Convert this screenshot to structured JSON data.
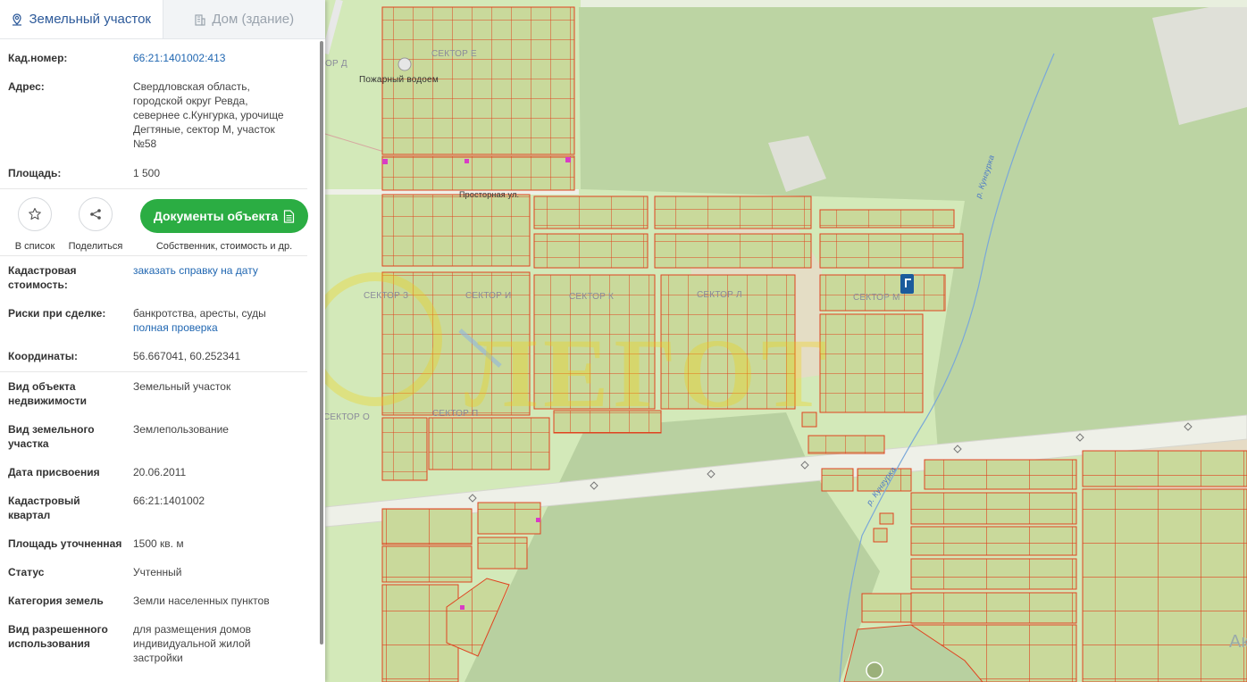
{
  "tabs": [
    {
      "label": "Земельный участок",
      "icon": "map-pin-icon",
      "active": true
    },
    {
      "label": "Дом (здание)",
      "icon": "building-icon",
      "active": false
    }
  ],
  "info_top": {
    "cad_number": {
      "label": "Кад.номер:",
      "value": "66:21:1401002:413"
    },
    "address": {
      "label": "Адрес:",
      "lines": [
        "Свердловская область,",
        "городской округ Ревда,",
        "севернее с.Кунгурка, урочище",
        "Дегтяные, сектор М, участок",
        "№58"
      ]
    },
    "area": {
      "label": "Площадь:",
      "value": "1 500"
    }
  },
  "actions": {
    "favorite": {
      "caption": "В список",
      "icon": "star-icon"
    },
    "share": {
      "caption": "Поделиться",
      "icon": "share-icon"
    },
    "documents": {
      "label": "Документы объекта",
      "caption": "Собственник, стоимость и др.",
      "icon": "document-icon"
    }
  },
  "details": [
    {
      "label": [
        "Кадастровая",
        "стоимость:"
      ],
      "value": [
        "заказать справку на дату"
      ],
      "link": [
        true
      ]
    },
    {
      "label": [
        "Риски при сделке:"
      ],
      "value": [
        "банкротства, аресты, суды",
        "полная проверка"
      ],
      "link": [
        false,
        true
      ]
    },
    {
      "label": [
        "Координаты:"
      ],
      "value": [
        "56.667041, 60.252341"
      ],
      "link": [
        false
      ]
    },
    {
      "label": [
        "Вид объекта",
        "недвижимости"
      ],
      "value": [
        "Земельный участок"
      ],
      "link": [
        false
      ]
    },
    {
      "label": [
        "Вид земельного",
        "участка"
      ],
      "value": [
        "Землепользование"
      ],
      "link": [
        false
      ]
    },
    {
      "label": [
        "Дата присвоения"
      ],
      "value": [
        "20.06.2011"
      ],
      "link": [
        false
      ]
    },
    {
      "label": [
        "Кадастровый",
        "квартал"
      ],
      "value": [
        "66:21:1401002"
      ],
      "link": [
        false
      ]
    },
    {
      "label": [
        "Площадь уточненная"
      ],
      "value": [
        "1500 кв. м"
      ],
      "link": [
        false
      ]
    },
    {
      "label": [
        "Статус"
      ],
      "value": [
        "Учтенный"
      ],
      "link": [
        false
      ]
    },
    {
      "label": [
        "Категория земель"
      ],
      "value": [
        "Земли населенных пунктов"
      ],
      "link": [
        false
      ]
    },
    {
      "label": [
        "Вид разрешенного",
        "использования"
      ],
      "value": [
        "для размещения домов",
        "индивидуальной жилой",
        "застройки"
      ],
      "link": [
        false
      ]
    }
  ],
  "map": {
    "labels": {
      "sector_e": "СЕКТОР Е",
      "sector_d": "ОР Д",
      "fire_pond": "Пожарный водоем",
      "street": "Просторная ул.",
      "sector_z": "СЕКТОР З",
      "sector_i": "СЕКТОР И",
      "sector_k": "СЕКТОР К",
      "sector_l": "СЕКТОР Л",
      "sector_m": "СЕКТОР М",
      "sector_o": "СЕКТОР О",
      "sector_p": "СЕКТОР П",
      "river_top": "р. Кунгурка",
      "river_bottom": "р. Кунгурка",
      "corner": "Ак"
    },
    "colors": {
      "parcel_fill": "#c9d99b",
      "parcel_stroke": "#e0421f",
      "forest": "#bcd4a3",
      "meadow": "#d3e9b9",
      "road": "#f1f1ec",
      "accent_green": "#2bad43",
      "link_blue": "#1f66b1",
      "marker": "#1b5b9c"
    }
  }
}
